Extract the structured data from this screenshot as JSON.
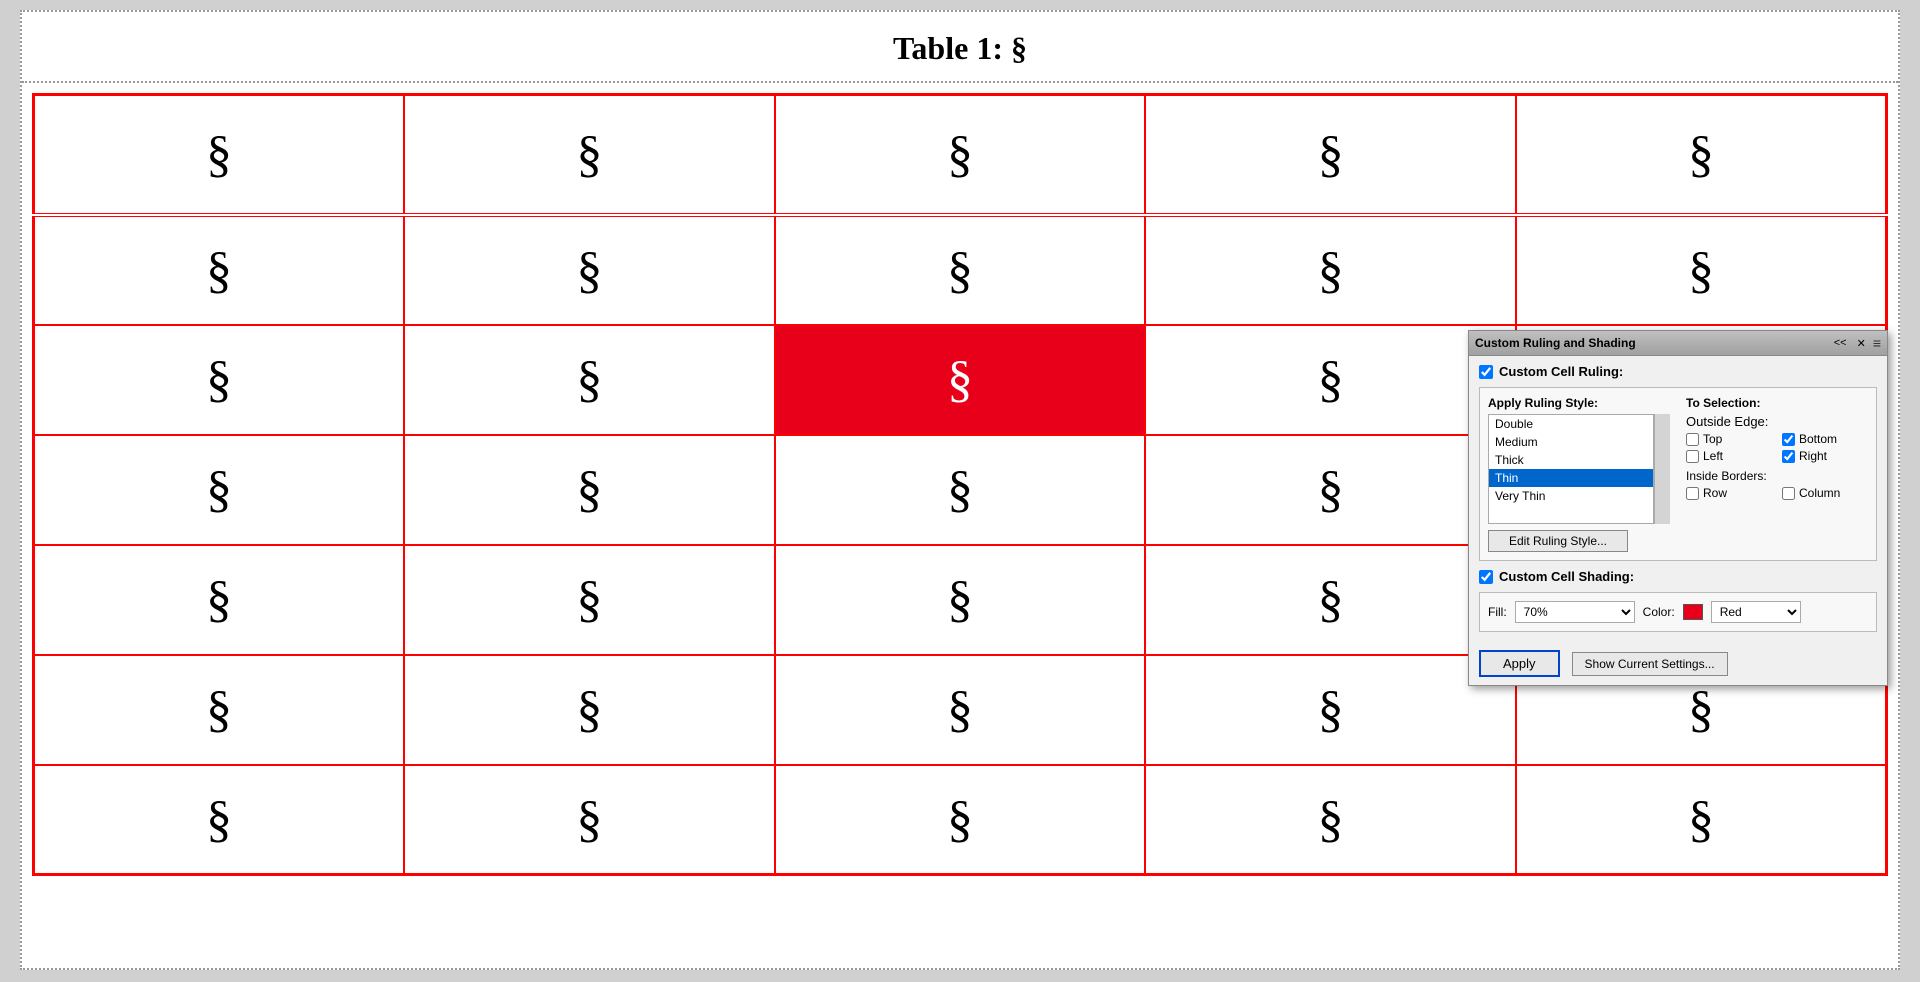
{
  "page": {
    "title": "Table 1: §",
    "symbol": "§"
  },
  "table": {
    "rows": 7,
    "cols": 5,
    "highlighted_row": 2,
    "highlighted_col": 2
  },
  "dialog": {
    "title": "Custom Ruling and Shading",
    "collapse_label": "<<",
    "close_label": "✕",
    "menu_label": "≡",
    "custom_ruling_label": "Custom Cell Ruling:",
    "apply_ruling_style_label": "Apply Ruling Style:",
    "to_selection_label": "To Selection:",
    "outside_edge_label": "Outside Edge:",
    "inside_borders_label": "Inside Borders:",
    "ruling_styles": [
      {
        "label": "Double",
        "selected": false
      },
      {
        "label": "Medium",
        "selected": false
      },
      {
        "label": "Thick",
        "selected": false
      },
      {
        "label": "Thin",
        "selected": true
      },
      {
        "label": "Very Thin",
        "selected": false
      }
    ],
    "outside_edge_options": [
      {
        "label": "Top",
        "checked": false
      },
      {
        "label": "Bottom",
        "checked": true
      },
      {
        "label": "Left",
        "checked": false
      },
      {
        "label": "Right",
        "checked": true
      }
    ],
    "inside_border_options": [
      {
        "label": "Row",
        "checked": false
      },
      {
        "label": "Column",
        "checked": false
      }
    ],
    "edit_ruling_btn_label": "Edit Ruling Style...",
    "custom_shading_label": "Custom Cell Shading:",
    "fill_label": "Fill:",
    "fill_value": "70%",
    "color_label": "Color:",
    "color_value": "Red",
    "apply_label": "Apply",
    "show_settings_label": "Show Current Settings..."
  }
}
